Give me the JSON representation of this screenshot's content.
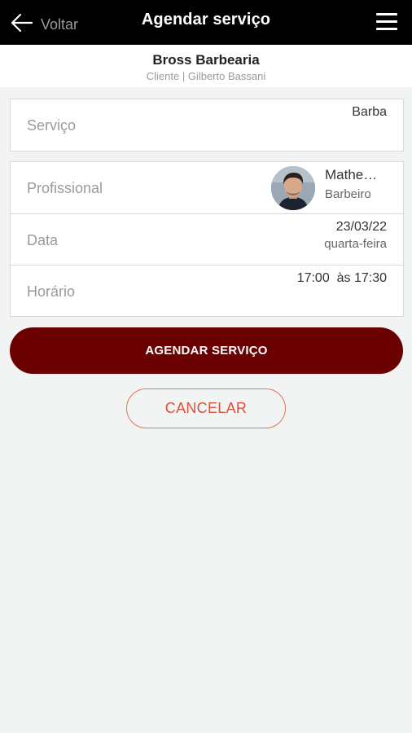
{
  "topbar": {
    "back_label": "Voltar",
    "title": "Agendar serviço",
    "back_icon": "arrow-left-icon",
    "menu_icon": "hamburger-menu-icon"
  },
  "shop": {
    "name": "Bross Barbearia",
    "client_line": "Cliente | Gilberto Bassani"
  },
  "service": {
    "label": "Serviço",
    "value": "Barba"
  },
  "details": {
    "professional": {
      "label": "Profissional",
      "name": "Mathe…",
      "role": "Barbeiro",
      "avatar_icon": "avatar-photo"
    },
    "date": {
      "label": "Data",
      "value": "23/03/22",
      "weekday": "quarta-feira"
    },
    "time": {
      "label": "Horário",
      "value": "17:00  às 17:30"
    }
  },
  "actions": {
    "schedule_label": "AGENDAR SERVIÇO",
    "cancel_label": "CANCELAR"
  },
  "colors": {
    "topbar": "#000000",
    "primary": "#6b0000",
    "cancel": "#e0735a",
    "background": "#f2f3f3"
  }
}
